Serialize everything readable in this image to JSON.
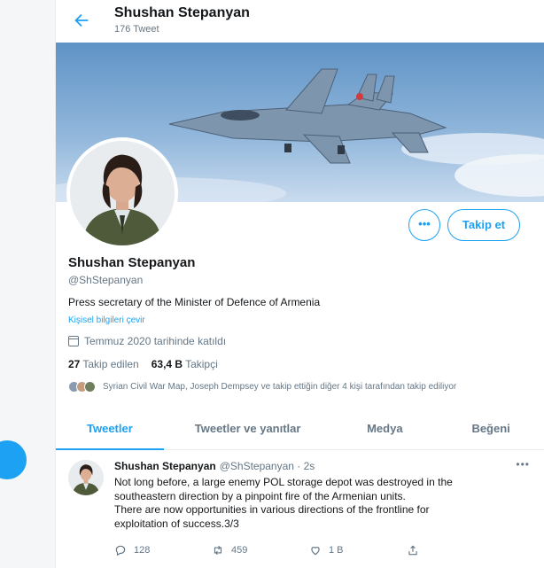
{
  "header": {
    "title": "Shushan Stepanyan",
    "tweet_count": "176 Tweet"
  },
  "profile": {
    "name": "Shushan Stepanyan",
    "handle": "@ShStepanyan",
    "bio": "Press secretary of the Minister of Defence of Armenia",
    "translate_link": "Kişisel bilgileri çevir",
    "joined": "Temmuz 2020 tarihinde katıldı",
    "following_count": "27",
    "following_label": "Takip edilen",
    "followers_count": "63,4 B",
    "followers_label": "Takipçi",
    "mutual_followers": "Syrian Civil War Map, Joseph Dempsey ve takip ettiğin diğer 4 kişi tarafından takip ediliyor",
    "more_label": "•••",
    "follow_label": "Takip et"
  },
  "tabs": [
    {
      "label": "Tweetler",
      "active": true
    },
    {
      "label": "Tweetler ve yanıtlar",
      "active": false
    },
    {
      "label": "Medya",
      "active": false
    },
    {
      "label": "Beğeni",
      "active": false
    }
  ],
  "tweet": {
    "name": "Shushan Stepanyan",
    "handle_time": "@ShStepanyan · 2s",
    "menu": "•••",
    "text_lines": [
      "Not long before, a large enemy POL storage depot was destroyed in the",
      "southeastern direction by a pinpoint fire of the Armenian units.",
      "There are now opportunities in various directions of the frontline for",
      "exploitation of success.3/3"
    ],
    "replies": "128",
    "retweets": "459",
    "likes": "1 B"
  },
  "colors": {
    "accent": "#1da1f2",
    "secondary_text": "#657786",
    "border": "#e6ecf0"
  },
  "icons": [
    "back-arrow-icon",
    "calendar-icon",
    "reply-icon",
    "retweet-icon",
    "like-icon",
    "share-icon",
    "more-icon"
  ]
}
